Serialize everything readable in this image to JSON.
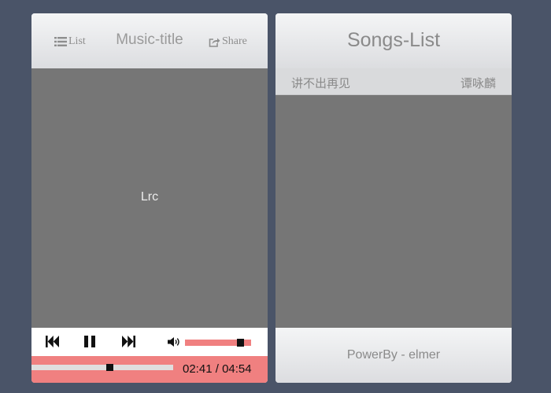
{
  "player": {
    "header": {
      "list_label": "List",
      "title": "Music-title",
      "share_label": "Share"
    },
    "lyrics": {
      "text": "Lrc"
    },
    "controls": {
      "volume_level": 0.84
    },
    "progress": {
      "fraction": 0.55,
      "current_time": "02:41",
      "separator": " / ",
      "total_time": "04:54"
    },
    "colors": {
      "accent": "#f08080",
      "panel_dark": "#767676",
      "background": "#4a5468"
    }
  },
  "songs_list": {
    "title": "Songs-List",
    "songs": [
      {
        "name": "讲不出再见",
        "artist": "谭咏麟"
      }
    ],
    "footer": "PowerBy - elmer"
  }
}
